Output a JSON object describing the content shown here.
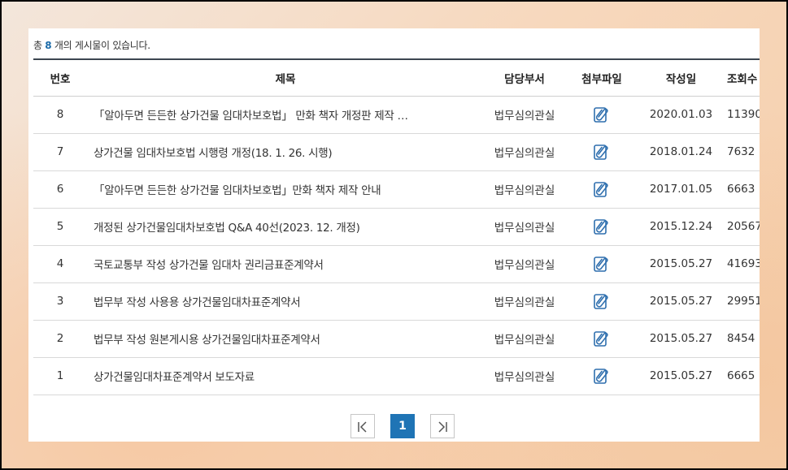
{
  "summary": {
    "prefix": "총",
    "count": "8",
    "suffix": "개의 게시물이 있습니다."
  },
  "table": {
    "headers": {
      "no": "번호",
      "title": "제목",
      "dept": "담당부서",
      "file": "첨부파일",
      "date": "작성일",
      "views": "조회수"
    },
    "rows": [
      {
        "no": "8",
        "title": "「알아두면 든든한 상가건물 임대차보호법」 만화 책자 개정판 제작 …",
        "dept": "법무심의관실",
        "file_icon": "attachment-icon",
        "date": "2020.01.03",
        "views": "11390"
      },
      {
        "no": "7",
        "title": "상가건물 임대차보호법 시행령 개정(18. 1. 26. 시행)",
        "dept": "법무심의관실",
        "file_icon": "attachment-icon",
        "date": "2018.01.24",
        "views": "7632"
      },
      {
        "no": "6",
        "title": "「알아두면 든든한 상가건물 임대차보호법」만화 책자 제작 안내",
        "dept": "법무심의관실",
        "file_icon": "attachment-icon",
        "date": "2017.01.05",
        "views": "6663"
      },
      {
        "no": "5",
        "title": "개정된 상가건물임대차보호법 Q&A 40선(2023. 12. 개정)",
        "dept": "법무심의관실",
        "file_icon": "attachment-icon",
        "date": "2015.12.24",
        "views": "20567"
      },
      {
        "no": "4",
        "title": "국토교통부 작성 상가건물 임대차 권리금표준계약서",
        "dept": "법무심의관실",
        "file_icon": "attachment-icon",
        "date": "2015.05.27",
        "views": "41693"
      },
      {
        "no": "3",
        "title": "법무부 작성 사용용 상가건물임대차표준계약서",
        "dept": "법무심의관실",
        "file_icon": "attachment-icon",
        "date": "2015.05.27",
        "views": "29951"
      },
      {
        "no": "2",
        "title": "법무부 작성 원본게시용 상가건물임대차표준계약서",
        "dept": "법무심의관실",
        "file_icon": "attachment-icon",
        "date": "2015.05.27",
        "views": "8454"
      },
      {
        "no": "1",
        "title": "상가건물임대차표준계약서 보도자료",
        "dept": "법무심의관실",
        "file_icon": "attachment-icon",
        "date": "2015.05.27",
        "views": "6665"
      }
    ]
  },
  "pagination": {
    "first_icon": "first-page-icon",
    "current": "1",
    "last_icon": "last-page-icon"
  },
  "colors": {
    "accent": "#1f74b5",
    "count_highlight": "#1a6aa8",
    "icon": "#2f6fae"
  }
}
